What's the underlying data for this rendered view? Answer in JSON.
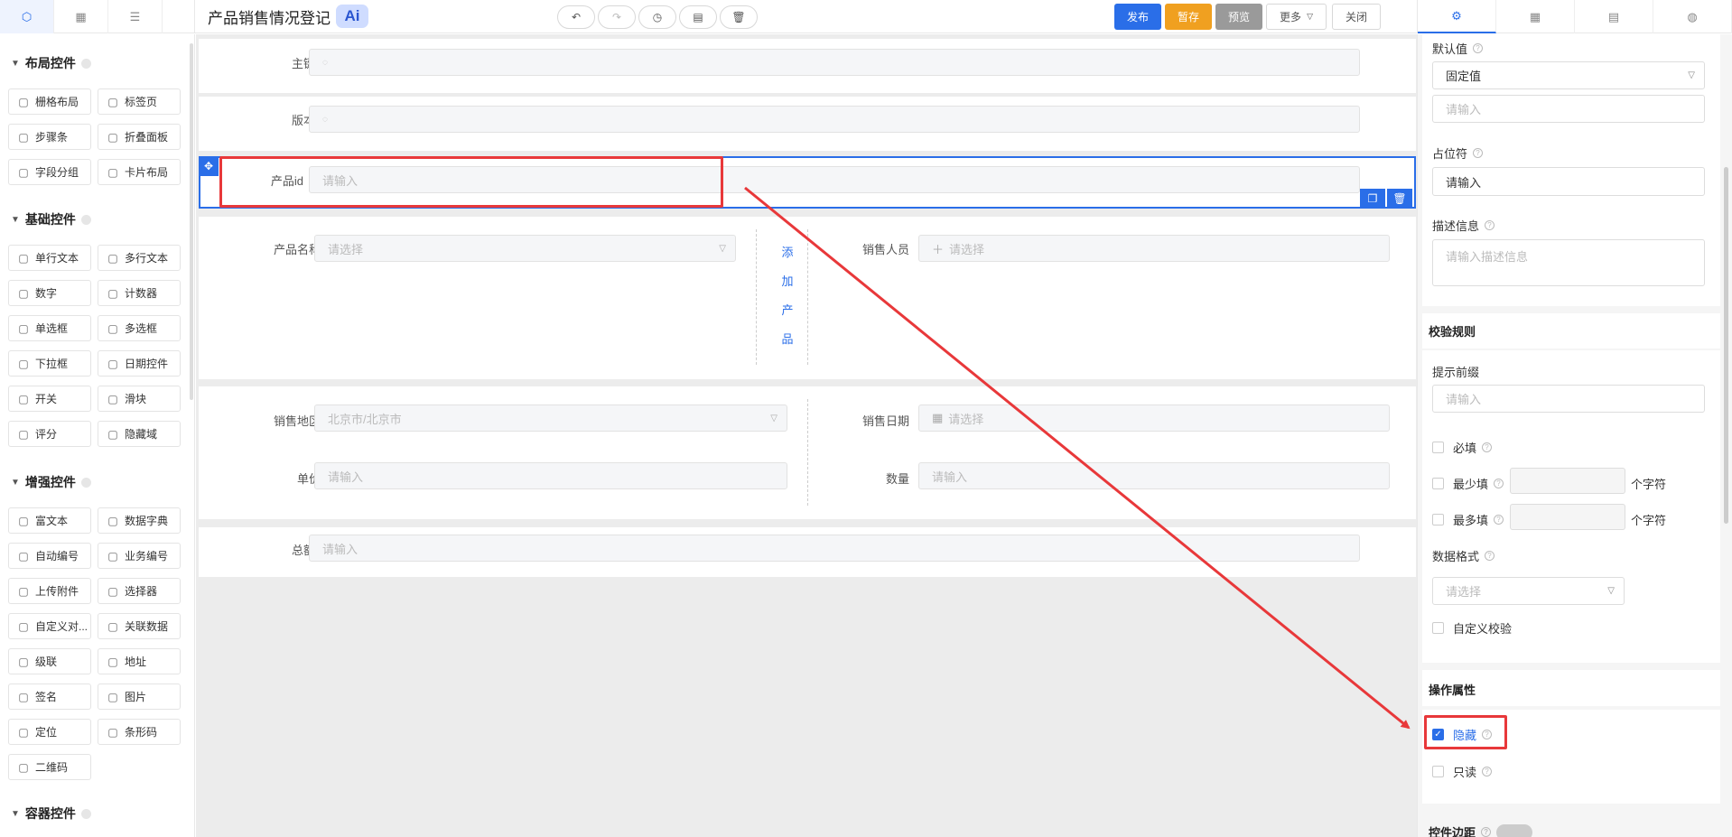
{
  "header": {
    "form_title": "产品销售情况登记",
    "ai_label": "Ai",
    "actions": [
      "发布",
      "暂存",
      "预览",
      "更多",
      "关闭"
    ]
  },
  "left_panel": {
    "groups": [
      {
        "title": "布局控件",
        "items": [
          {
            "label": "栅格布局",
            "icon": "grid-layout-icon"
          },
          {
            "label": "标签页",
            "icon": "tabs-icon"
          },
          {
            "label": "步骤条",
            "icon": "steps-icon"
          },
          {
            "label": "折叠面板",
            "icon": "collapse-icon"
          },
          {
            "label": "字段分组",
            "icon": "field-group-icon"
          },
          {
            "label": "卡片布局",
            "icon": "card-icon"
          }
        ]
      },
      {
        "title": "基础控件",
        "items": [
          {
            "label": "单行文本",
            "icon": "text-icon"
          },
          {
            "label": "多行文本",
            "icon": "textarea-icon"
          },
          {
            "label": "数字",
            "icon": "number-icon"
          },
          {
            "label": "计数器",
            "icon": "counter-icon"
          },
          {
            "label": "单选框",
            "icon": "radio-icon"
          },
          {
            "label": "多选框",
            "icon": "checkbox-icon"
          },
          {
            "label": "下拉框",
            "icon": "select-icon"
          },
          {
            "label": "日期控件",
            "icon": "calendar-icon"
          },
          {
            "label": "开关",
            "icon": "switch-icon"
          },
          {
            "label": "滑块",
            "icon": "slider-icon"
          },
          {
            "label": "评分",
            "icon": "star-icon"
          },
          {
            "label": "隐藏域",
            "icon": "eye-off-icon"
          }
        ]
      },
      {
        "title": "增强控件",
        "items": [
          {
            "label": "富文本",
            "icon": "richtext-icon"
          },
          {
            "label": "数据字典",
            "icon": "dictionary-icon"
          },
          {
            "label": "自动编号",
            "icon": "auto-number-icon"
          },
          {
            "label": "业务编号",
            "icon": "business-number-icon"
          },
          {
            "label": "上传附件",
            "icon": "upload-icon"
          },
          {
            "label": "选择器",
            "icon": "selector-icon"
          },
          {
            "label": "自定义对...",
            "icon": "custom-dialog-icon"
          },
          {
            "label": "关联数据",
            "icon": "link-icon"
          },
          {
            "label": "级联",
            "icon": "cascade-icon"
          },
          {
            "label": "地址",
            "icon": "location-icon"
          },
          {
            "label": "签名",
            "icon": "signature-icon"
          },
          {
            "label": "图片",
            "icon": "image-icon"
          },
          {
            "label": "定位",
            "icon": "locate-icon"
          },
          {
            "label": "条形码",
            "icon": "barcode-icon"
          },
          {
            "label": "二维码",
            "icon": "qrcode-icon"
          }
        ]
      },
      {
        "title": "容器控件",
        "items": []
      }
    ]
  },
  "canvas": {
    "primary_key": {
      "label": "主键"
    },
    "version": {
      "label": "版本"
    },
    "product_id": {
      "label": "产品id",
      "placeholder": "请输入"
    },
    "product_name": {
      "label": "产品名称",
      "placeholder": "请选择"
    },
    "add_product": [
      "添",
      "加",
      "产",
      "品"
    ],
    "salesperson": {
      "label": "销售人员",
      "placeholder": "请选择"
    },
    "region": {
      "label": "销售地区",
      "value": "北京市/北京市"
    },
    "sale_date": {
      "label": "销售日期",
      "placeholder": "请选择"
    },
    "unit_price": {
      "label": "单价",
      "placeholder": "请输入"
    },
    "quantity": {
      "label": "数量",
      "placeholder": "请输入"
    },
    "total": {
      "label": "总额",
      "placeholder": "请输入"
    }
  },
  "right_panel": {
    "default_value": {
      "label": "默认值",
      "mode": "固定值",
      "placeholder": "请输入"
    },
    "placeholder_field": {
      "label": "占位符",
      "value": "请输入"
    },
    "description": {
      "label": "描述信息",
      "placeholder": "请输入描述信息"
    },
    "validation": {
      "title": "校验规则",
      "prefix_label": "提示前缀",
      "prefix_placeholder": "请输入",
      "required": "必填",
      "min_label": "最少填",
      "max_label": "最多填",
      "unit": "个字符",
      "format_label": "数据格式",
      "format_placeholder": "请选择",
      "custom": "自定义校验"
    },
    "operation": {
      "title": "操作属性",
      "hidden": "隐藏",
      "readonly": "只读",
      "margin": "控件边距"
    }
  },
  "colors": {
    "accent": "#2a6ee8",
    "highlight": "#e8383a",
    "publish": "#2a6ee8",
    "save": "#f0a020",
    "preview": "#9a9a9a"
  }
}
